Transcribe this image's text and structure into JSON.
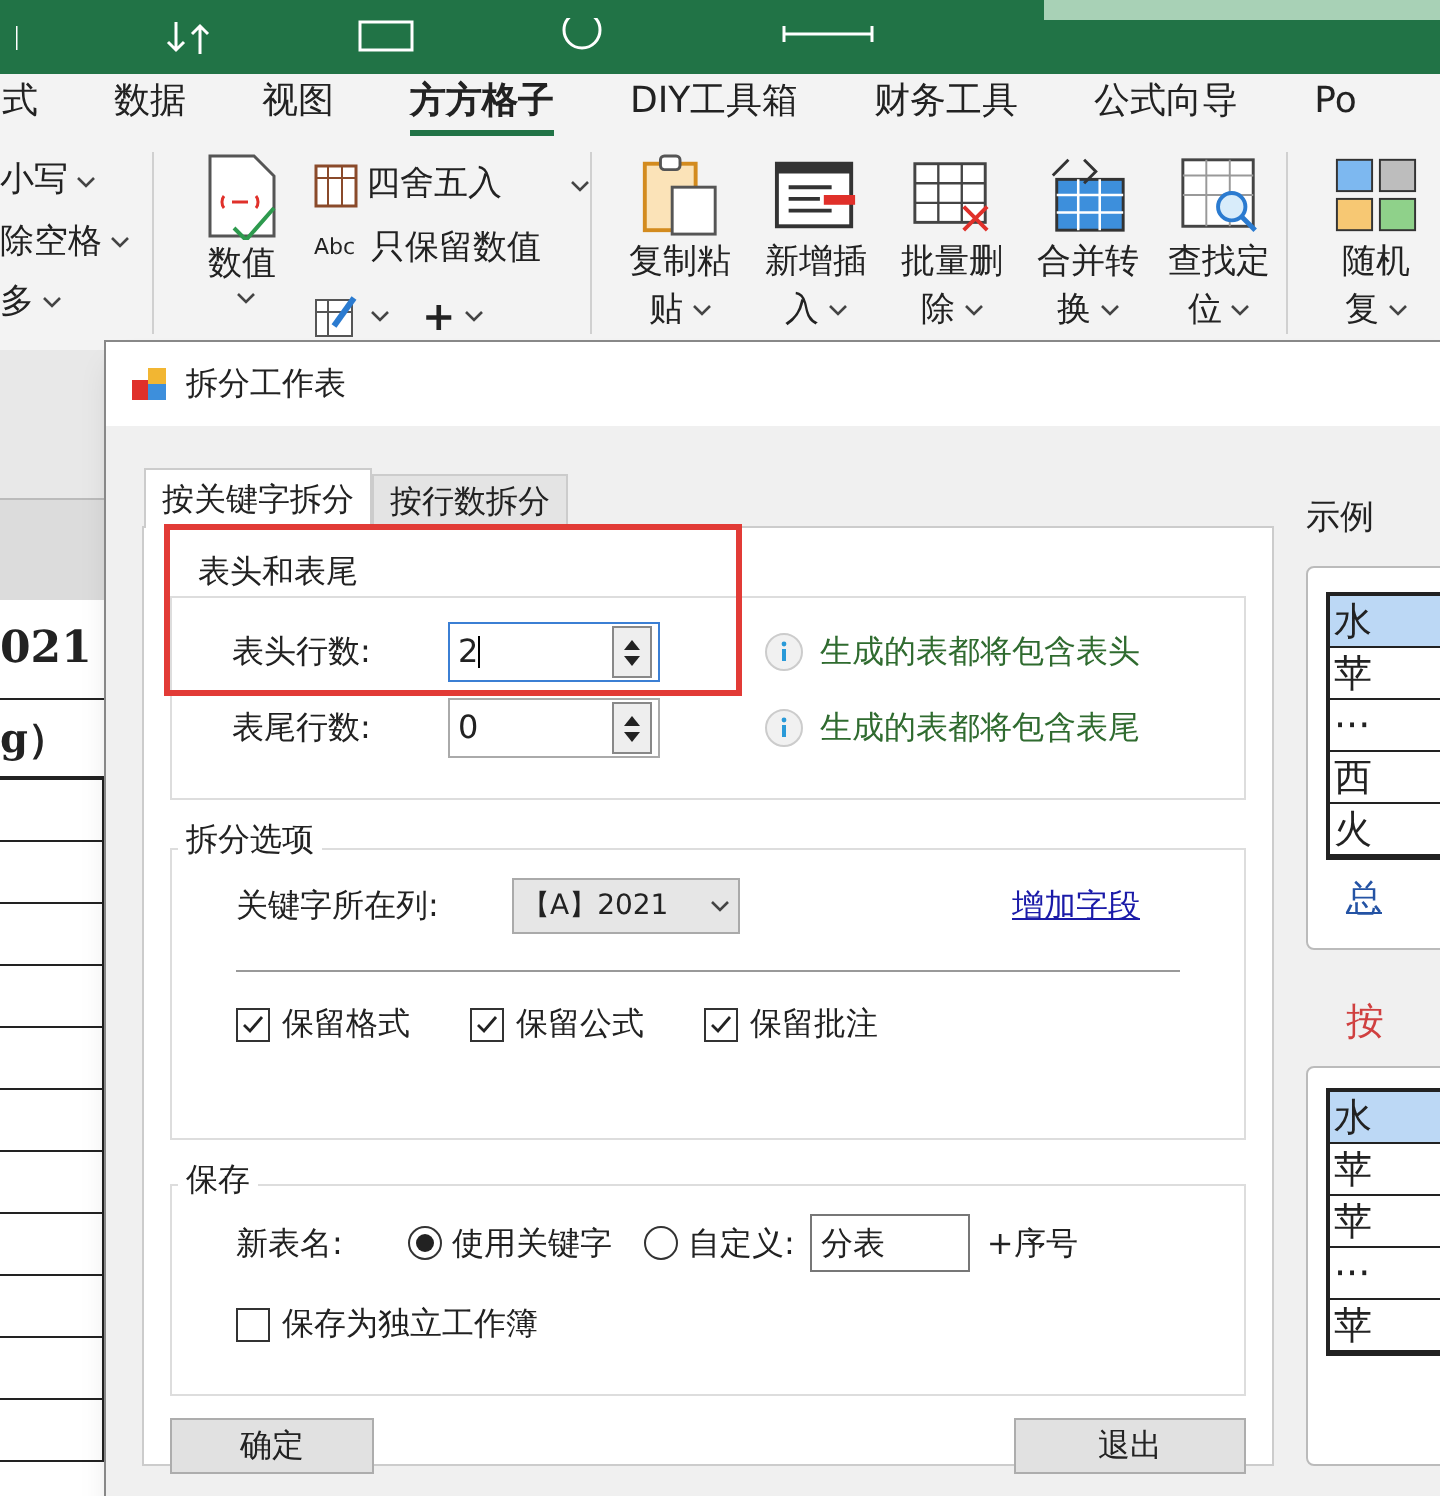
{
  "ribbon_tabs": [
    {
      "label": "式",
      "selected": false
    },
    {
      "label": "数据",
      "selected": false
    },
    {
      "label": "视图",
      "selected": false
    },
    {
      "label": "方方格子",
      "selected": true
    },
    {
      "label": "DIY工具箱",
      "selected": false
    },
    {
      "label": "财务工具",
      "selected": false
    },
    {
      "label": "公式向导",
      "selected": false
    },
    {
      "label": "Po",
      "selected": false
    }
  ],
  "text_menu": [
    "小写",
    "除空格",
    "多"
  ],
  "number_group": {
    "big_button": "数值",
    "round": "四舍五入",
    "keep_value": "只保留数值",
    "abc": "Abc",
    "plus": "+"
  },
  "big_buttons": [
    {
      "kind": "clipboard",
      "lines": [
        "复制粘",
        "贴"
      ]
    },
    {
      "kind": "insert",
      "lines": [
        "新增插",
        "入"
      ]
    },
    {
      "kind": "delete",
      "lines": [
        "批量删",
        "除"
      ]
    },
    {
      "kind": "merge",
      "lines": [
        "合并转",
        "换"
      ]
    },
    {
      "kind": "find",
      "lines": [
        "查找定",
        "位"
      ]
    },
    {
      "kind": "tiles",
      "lines": [
        "随机",
        "复"
      ]
    }
  ],
  "sheet": {
    "title": "021",
    "unit": "g）"
  },
  "dialog": {
    "title": "拆分工作表",
    "tabs": [
      {
        "label": "按关键字拆分",
        "selected": true
      },
      {
        "label": "按行数拆分",
        "selected": false
      }
    ],
    "header_group": {
      "title": "表头和表尾",
      "rows": [
        {
          "label": "表头行数:",
          "value": "2",
          "focused": true,
          "hint": "生成的表都将包含表头"
        },
        {
          "label": "表尾行数:",
          "value": "0",
          "focused": false,
          "hint": "生成的表都将包含表尾"
        }
      ]
    },
    "split_group": {
      "title": "拆分选项",
      "key_label": "关键字所在列:",
      "key_value": "【A】2021",
      "add_link": "增加字段",
      "options": [
        {
          "label": "保留格式",
          "checked": true
        },
        {
          "label": "保留公式",
          "checked": true
        },
        {
          "label": "保留批注",
          "checked": true
        }
      ]
    },
    "save_group": {
      "title": "保存",
      "name_label": "新表名:",
      "radios": [
        {
          "label": "使用关键字",
          "selected": true
        },
        {
          "label": "自定义:",
          "selected": false
        }
      ],
      "custom_value": "分表",
      "suffix": "+序号",
      "standalone": {
        "label": "保存为独立工作簿",
        "checked": false
      }
    },
    "ok": "确定",
    "exit": "退出",
    "example": {
      "title": "示例",
      "table_1": [
        "水",
        "苹",
        "···",
        "西",
        "火"
      ],
      "sheet_tab": "总",
      "caption": "按",
      "table_2": [
        "水",
        "苹",
        "苹",
        "···",
        "苹"
      ]
    }
  }
}
